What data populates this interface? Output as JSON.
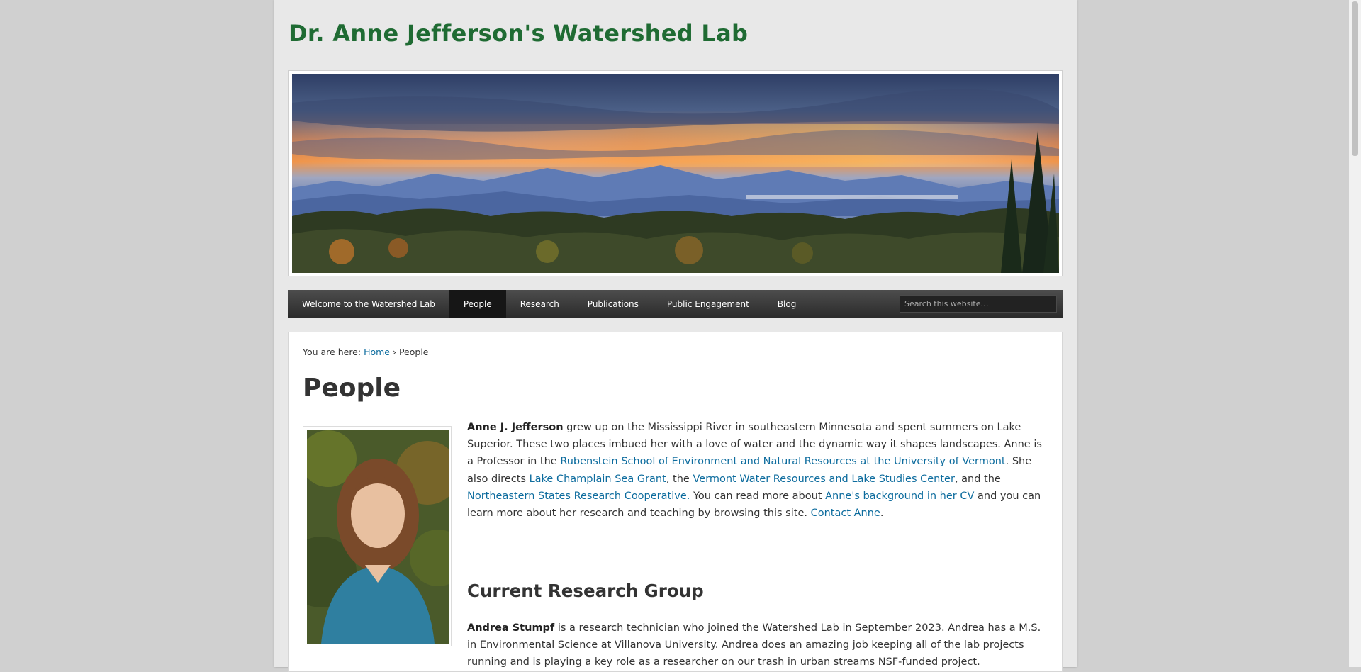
{
  "site": {
    "title": "Dr. Anne Jefferson's Watershed Lab"
  },
  "nav": {
    "items": [
      {
        "label": "Welcome to the Watershed Lab"
      },
      {
        "label": "People"
      },
      {
        "label": "Research"
      },
      {
        "label": "Publications"
      },
      {
        "label": "Public Engagement"
      },
      {
        "label": "Blog"
      }
    ],
    "active_index": 1,
    "search_placeholder": "Search this website…"
  },
  "breadcrumb": {
    "prefix": "You are here:",
    "home": "Home",
    "separator": "›",
    "current": "People"
  },
  "page": {
    "title": "People"
  },
  "bio": {
    "name": "Anne J. Jefferson",
    "t1": " grew up on the Mississippi River in southeastern Minnesota and spent summers on Lake Superior. These two places imbued her with a love of water and the dynamic way it shapes landscapes. Anne is a Professor in the ",
    "link_rubenstein": "Rubenstein School of Environment and Natural Resources at the University of Vermont",
    "t2": ". She also directs ",
    "link_seagrant": "Lake Champlain Sea Grant",
    "t3": ", the ",
    "link_vwrlsc": "Vermont Water Resources and Lake Studies Center",
    "t4": ", and the ",
    "link_nsrc": "Northeastern States Research Cooperative.",
    "t5": " You can read more about ",
    "link_cv": "Anne's background in her CV",
    "t6": " and you can learn more about her research and teaching by browsing this site. ",
    "link_contact": "Contact Anne",
    "t7": "."
  },
  "group": {
    "title": "Current Research Group",
    "members": [
      {
        "name": "Andrea Stumpf",
        "text": " is a research technician who joined the Watershed Lab in September 2023. Andrea has a M.S. in Environmental Science at Villanova University. Andrea does an amazing job keeping all of the lab projects running and is playing a key role as a researcher on our trash in urban streams NSF-funded project."
      }
    ]
  },
  "colors": {
    "title_green": "#1f6b33",
    "link_blue": "#0d6c9e",
    "nav_dark": "#333333",
    "nav_active": "#161616"
  }
}
